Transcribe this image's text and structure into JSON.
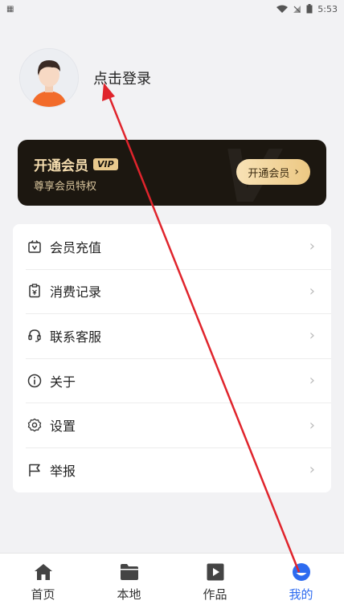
{
  "status": {
    "time": "5:53"
  },
  "profile": {
    "login_text": "点击登录"
  },
  "vip": {
    "title": "开通会员",
    "badge": "VIP",
    "subtitle": "尊享会员特权",
    "button_label": "开通会员",
    "watermark": "V"
  },
  "menu": {
    "items": [
      {
        "label": "会员充值",
        "icon": "recharge-icon"
      },
      {
        "label": "消费记录",
        "icon": "receipt-icon"
      },
      {
        "label": "联系客服",
        "icon": "headset-icon"
      },
      {
        "label": "关于",
        "icon": "info-icon"
      },
      {
        "label": "设置",
        "icon": "gear-icon"
      },
      {
        "label": "举报",
        "icon": "flag-icon"
      }
    ]
  },
  "tabs": [
    {
      "label": "首页",
      "icon": "home-icon",
      "active": false
    },
    {
      "label": "本地",
      "icon": "folder-icon",
      "active": false
    },
    {
      "label": "作品",
      "icon": "play-icon",
      "active": false
    },
    {
      "label": "我的",
      "icon": "profile-icon",
      "active": true
    }
  ],
  "colors": {
    "accent": "#2d6bf0",
    "vip_gold": "#e9c98d",
    "vip_bg": "#1c1710",
    "annotation_arrow": "#e0242c"
  }
}
